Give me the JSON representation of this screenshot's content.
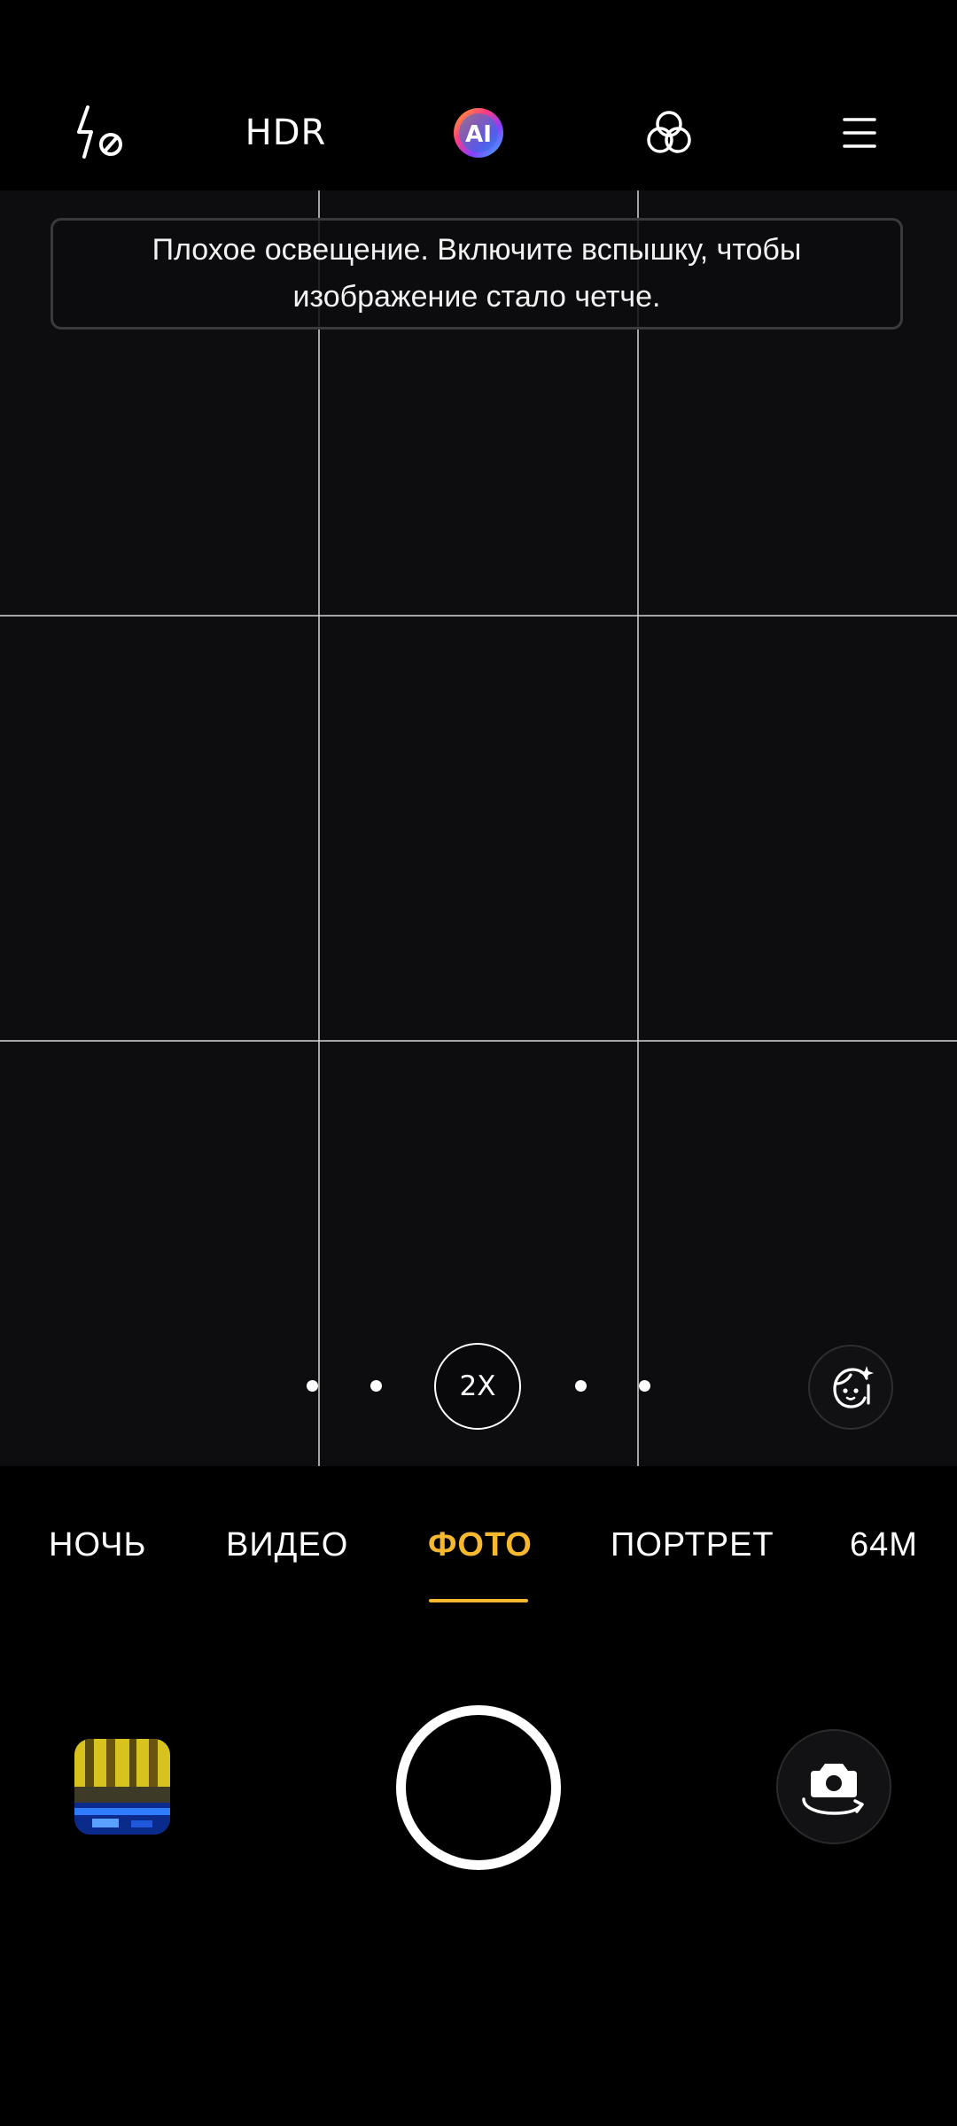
{
  "top_bar": {
    "flash_icon": "flash-off-icon",
    "hdr_label": "HDR",
    "ai_label": "AI",
    "filters_icon": "filters-icon",
    "menu_icon": "menu-icon"
  },
  "viewfinder": {
    "hint": "Плохое освещение. Включите вспышку, чтобы изображение стало четче.",
    "zoom_label": "2X",
    "beauty_icon": "beauty-face-icon"
  },
  "modes": {
    "items": [
      "НОЧЬ",
      "ВИДЕО",
      "ФОТО",
      "ПОРТРЕТ",
      "64M"
    ],
    "active": "ФОТО"
  },
  "bottom": {
    "gallery_icon": "gallery-thumbnail",
    "shutter_icon": "shutter-icon",
    "switch_icon": "switch-camera-icon"
  },
  "colors": {
    "accent": "#f5b82e",
    "background": "#000000",
    "viewfinder": "#0d0d0f"
  }
}
